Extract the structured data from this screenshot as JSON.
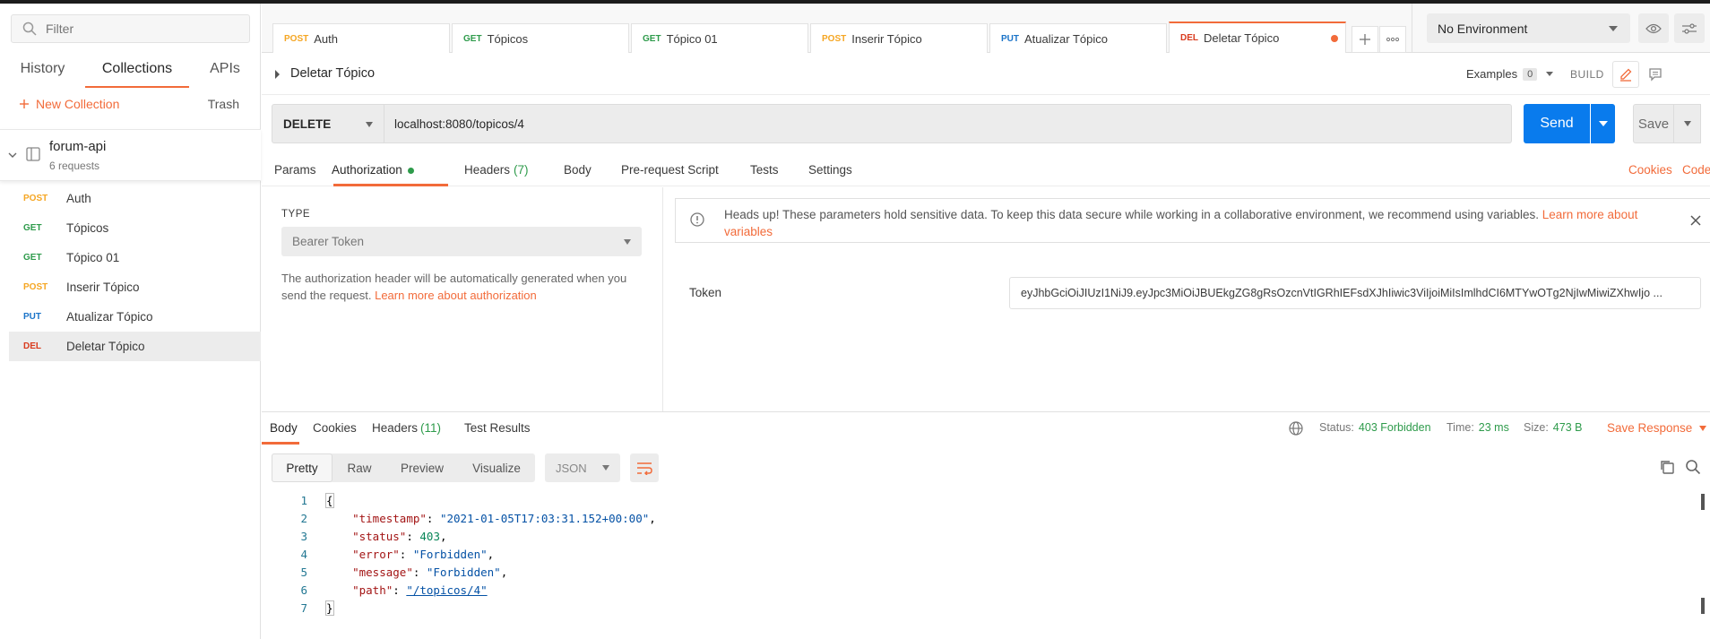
{
  "colors": {
    "accent": "#f26b3a",
    "send_blue": "#097bed",
    "post": "#f5a623",
    "get": "#2e9b4b",
    "put": "#1a73c8",
    "del": "#d93b1e",
    "status_green": "#2e9b4b"
  },
  "sidebar": {
    "filter_placeholder": "Filter",
    "tabs": [
      {
        "label": "History"
      },
      {
        "label": "Collections",
        "active": true
      },
      {
        "label": "APIs"
      }
    ],
    "new_collection": "New Collection",
    "trash": "Trash",
    "collection": {
      "name": "forum-api",
      "count": "6 requests"
    },
    "requests": [
      {
        "method": "POST",
        "name": "Auth"
      },
      {
        "method": "GET",
        "name": "Tópicos"
      },
      {
        "method": "GET",
        "name": "Tópico 01"
      },
      {
        "method": "POST",
        "name": "Inserir Tópico"
      },
      {
        "method": "PUT",
        "name": "Atualizar Tópico"
      },
      {
        "method": "DEL",
        "name": "Deletar Tópico",
        "active": true
      }
    ]
  },
  "tabs": [
    {
      "method": "POST",
      "name": "Auth"
    },
    {
      "method": "GET",
      "name": "Tópicos"
    },
    {
      "method": "GET",
      "name": "Tópico 01"
    },
    {
      "method": "POST",
      "name": "Inserir Tópico"
    },
    {
      "method": "PUT",
      "name": "Atualizar Tópico"
    },
    {
      "method": "DEL",
      "name": "Deletar Tópico",
      "active": true
    }
  ],
  "environment": {
    "selected": "No Environment"
  },
  "request": {
    "name": "Deletar Tópico",
    "examples_label": "Examples",
    "examples_count": "0",
    "build_label": "BUILD",
    "method": "DELETE",
    "url": "localhost:8080/topicos/4",
    "send_label": "Send",
    "save_label": "Save",
    "sub_tabs": {
      "params": "Params",
      "authorization": "Authorization",
      "headers": "Headers",
      "headers_count": "(7)",
      "body": "Body",
      "pre_request": "Pre-request Script",
      "tests": "Tests",
      "settings": "Settings",
      "cookies": "Cookies",
      "code": "Code"
    }
  },
  "auth": {
    "type_label": "TYPE",
    "type_value": "Bearer Token",
    "desc": "The authorization header will be automatically generated when you send the request.",
    "desc_link": "Learn more about authorization",
    "heads_up": "Heads up! These parameters hold sensitive data. To keep this data secure while working in a collaborative environment, we recommend using variables.",
    "heads_up_link": "Learn more about variables",
    "token_label": "Token",
    "token_value": "eyJhbGciOiJIUzI1NiJ9.eyJpc3MiOiJBUEkgZG8gRsOzcnVtIGRhIEFsdXJhIiwic3ViIjoiMiIsImlhdCI6MTYwOTg2NjIwMiwiZXhwIjo ..."
  },
  "response": {
    "tabs": {
      "body": "Body",
      "cookies": "Cookies",
      "headers": "Headers",
      "headers_count": "(11)",
      "test_results": "Test Results"
    },
    "status_label": "Status:",
    "status_value": "403 Forbidden",
    "time_label": "Time:",
    "time_value": "23 ms",
    "size_label": "Size:",
    "size_value": "473 B",
    "save_response": "Save Response",
    "formats": [
      "Pretty",
      "Raw",
      "Preview",
      "Visualize"
    ],
    "active_format": "Pretty",
    "language": "JSON",
    "body_lines": [
      {
        "n": "1",
        "text": "{"
      },
      {
        "n": "2",
        "key": "\"timestamp\"",
        "value": "\"2021-01-05T17:03:31.152+00:00\"",
        "type": "str",
        "comma": true
      },
      {
        "n": "3",
        "key": "\"status\"",
        "value": "403",
        "type": "num",
        "comma": true
      },
      {
        "n": "4",
        "key": "\"error\"",
        "value": "\"Forbidden\"",
        "type": "str",
        "comma": true
      },
      {
        "n": "5",
        "key": "\"message\"",
        "value": "\"Forbidden\"",
        "type": "str",
        "comma": true
      },
      {
        "n": "6",
        "key": "\"path\"",
        "value": "\"/topicos/4\"",
        "type": "url",
        "comma": false
      },
      {
        "n": "7",
        "text": "}"
      }
    ]
  }
}
